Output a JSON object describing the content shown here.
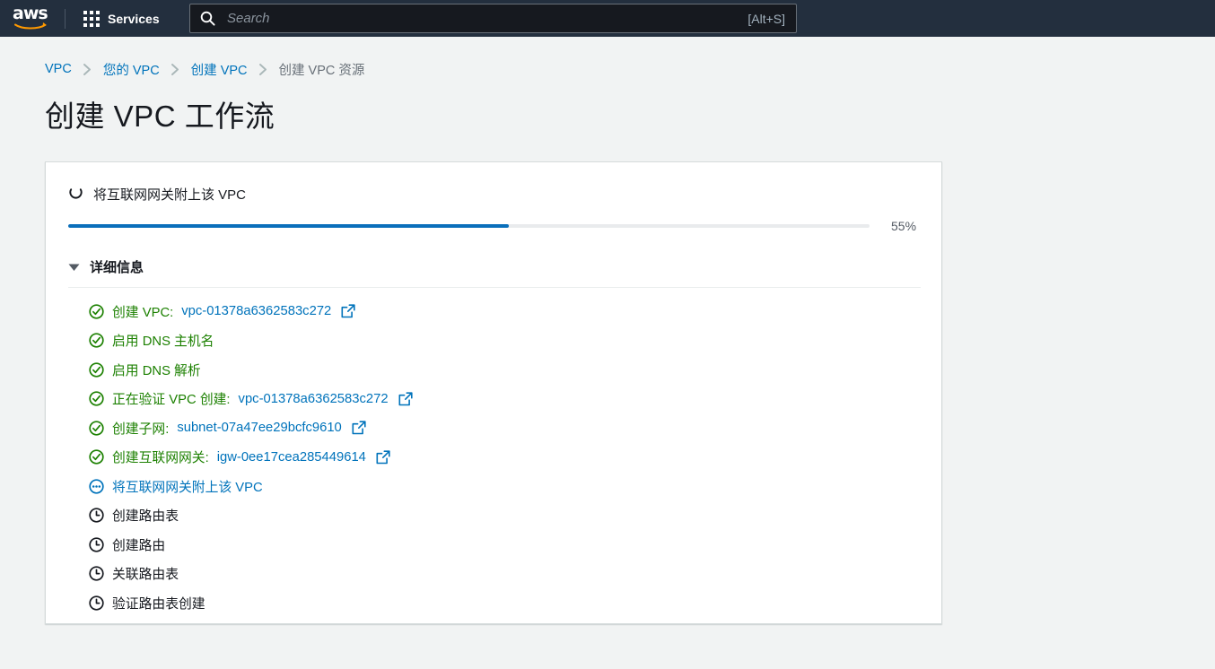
{
  "topnav": {
    "logo_text": "aws",
    "logo_name": "aws-logo",
    "services_label": "Services",
    "grid_icon": "grid-menu-icon",
    "search": {
      "icon": "search-icon",
      "placeholder": "Search",
      "value": "",
      "shortcut_hint": "[Alt+S]"
    }
  },
  "breadcrumb": {
    "items": [
      {
        "label": "VPC",
        "current": false
      },
      {
        "label": "您的 VPC",
        "current": false
      },
      {
        "label": "创建 VPC",
        "current": false
      },
      {
        "label": "创建 VPC 资源",
        "current": true
      }
    ],
    "separator_icon": "chevron-right-icon"
  },
  "page": {
    "title": "创建 VPC 工作流"
  },
  "card": {
    "status": {
      "icon": "spinner-icon",
      "text": "将互联网网关附上该 VPC"
    },
    "progress": {
      "percent": 55,
      "percent_label": "55%",
      "fill_color": "#0a6fbb",
      "track_color": "#e9ebed"
    },
    "details": {
      "caret_icon": "caret-down-icon",
      "title": "详细信息",
      "steps": [
        {
          "state": "done",
          "icon": "check-circle-icon",
          "label": "创建 VPC:",
          "link": "vpc-01378a6362583c272",
          "external_icon": "external-link-icon"
        },
        {
          "state": "done",
          "icon": "check-circle-icon",
          "label": "启用 DNS 主机名",
          "link": "",
          "external_icon": ""
        },
        {
          "state": "done",
          "icon": "check-circle-icon",
          "label": "启用 DNS 解析",
          "link": "",
          "external_icon": ""
        },
        {
          "state": "done",
          "icon": "check-circle-icon",
          "label": "正在验证 VPC 创建:",
          "link": "vpc-01378a6362583c272",
          "external_icon": "external-link-icon"
        },
        {
          "state": "done",
          "icon": "check-circle-icon",
          "label": "创建子网:",
          "link": "subnet-07a47ee29bcfc9610",
          "external_icon": "external-link-icon"
        },
        {
          "state": "done",
          "icon": "check-circle-icon",
          "label": "创建互联网网关:",
          "link": "igw-0ee17cea285449614",
          "external_icon": "external-link-icon"
        },
        {
          "state": "inprogress",
          "icon": "in-progress-icon",
          "label": "将互联网网关附上该 VPC",
          "link": "",
          "external_icon": ""
        },
        {
          "state": "pending",
          "icon": "clock-icon",
          "label": "创建路由表",
          "link": "",
          "external_icon": ""
        },
        {
          "state": "pending",
          "icon": "clock-icon",
          "label": "创建路由",
          "link": "",
          "external_icon": ""
        },
        {
          "state": "pending",
          "icon": "clock-icon",
          "label": "关联路由表",
          "link": "",
          "external_icon": ""
        },
        {
          "state": "pending",
          "icon": "clock-icon",
          "label": "验证路由表创建",
          "link": "",
          "external_icon": ""
        }
      ]
    }
  },
  "colors": {
    "nav_bg": "#232f3e",
    "link": "#0073bb",
    "success": "#1d8102",
    "page_bg": "#f1f3f3",
    "text": "#16191f"
  }
}
